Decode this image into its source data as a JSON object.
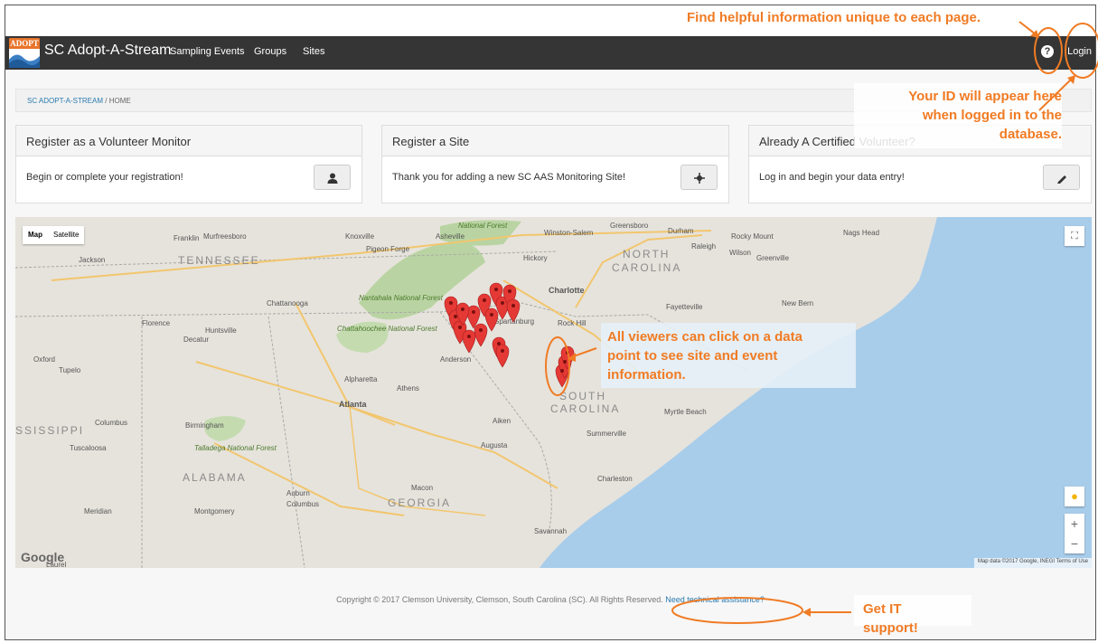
{
  "header": {
    "logo_text": "ADOPT",
    "brand": "SC Adopt-A-Stream",
    "nav": [
      "Sampling Events",
      "Groups",
      "Sites"
    ],
    "help_icon": "question-circle-icon",
    "login_label": "Login"
  },
  "breadcrumb": {
    "root": "SC ADOPT-A-STREAM",
    "separator": "/",
    "current": "HOME"
  },
  "panels": [
    {
      "title": "Register as a Volunteer Monitor",
      "body": "Begin or complete your registration!",
      "icon": "user-icon"
    },
    {
      "title": "Register a Site",
      "body": "Thank you for adding a new SC AAS Monitoring Site!",
      "icon": "crosshair-icon"
    },
    {
      "title": "Already A Certified Volunteer?",
      "body": "Log in and begin your data entry!",
      "icon": "pencil-icon"
    }
  ],
  "map": {
    "type_map": "Map",
    "type_satellite": "Satellite",
    "labels": {
      "tennessee": "TENNESSEE",
      "north_carolina_1": "NORTH",
      "north_carolina_2": "CAROLINA",
      "south_carolina_1": "SOUTH",
      "south_carolina_2": "CAROLINA",
      "alabama": "ALABAMA",
      "georgia": "GEORGIA",
      "mississippi": "SSISSIPPI",
      "knoxville": "Knoxville",
      "asheville": "Asheville",
      "charlotte": "Charlotte",
      "atlanta": "Atlanta",
      "athens": "Athens",
      "anderson": "Anderson",
      "augusta": "Augusta",
      "charleston": "Charleston",
      "savannah": "Savannah",
      "birmingham": "Birmingham",
      "montgomery": "Montgomery",
      "macon": "Macon",
      "chattanooga": "Chattanooga",
      "huntsville": "Huntsville",
      "greensboro": "Greensboro",
      "durham": "Durham",
      "raleigh": "Raleigh",
      "fayetteville": "Fayetteville",
      "myrtle_beach": "Myrtle Beach",
      "jackson": "Jackson",
      "murfreesboro": "Murfreesboro",
      "tupelo": "Tupelo",
      "columbus": "Columbus",
      "tuscaloosa": "Tuscaloosa",
      "aiken": "Aiken",
      "wilson": "Wilson",
      "greenville": "Greenville",
      "new_bern": "New Bern",
      "rocky_mount": "Rocky Mount",
      "hickory": "Hickory",
      "rock_hill": "Rock Hill",
      "spartanburg": "Spartanburg",
      "alpharetta": "Alpharetta",
      "decatur": "Decatur",
      "florence": "Florence",
      "oxford": "Oxford",
      "auburn": "Auburn",
      "meridian": "Meridian",
      "summerville": "Summerville",
      "franklin": "Franklin",
      "pigeon_forge": "Pigeon Forge",
      "winston_salem": "Winston-Salem",
      "nags_head": "Nags Head",
      "laurel": "Laurel",
      "nantahala": "Nantahala National Forest",
      "chattahoochee": "Chattahoochee National Forest",
      "talladega": "Talladega National Forest",
      "national_forest": "National Forest"
    },
    "google": "Google",
    "attribution": "Map data ©2017 Google, INEGI   Terms of Use",
    "fullscreen_icon": "fullscreen-icon",
    "pegman_icon": "pegman-icon",
    "zoom_in": "+",
    "zoom_out": "−"
  },
  "footer": {
    "copyright": "Copyright © 2017 Clemson University, Clemson, South Carolina (SC). All Rights Reserved.",
    "link": "Need technical assistance?"
  },
  "annotations": {
    "help": "Find helpful information unique to each page.",
    "login_1": "Your ID will appear here",
    "login_2": "when logged in to the",
    "login_3": "database.",
    "map_1": "All viewers can click on a data",
    "map_2": "point to see site and event",
    "map_3": "information.",
    "support_1": "Get IT",
    "support_2": "support!"
  },
  "colors": {
    "accent_annotation": "#f07b24",
    "navbar": "#353535",
    "marker": "#e53935",
    "link": "#2a7ab0",
    "water": "#a8cdeb"
  }
}
